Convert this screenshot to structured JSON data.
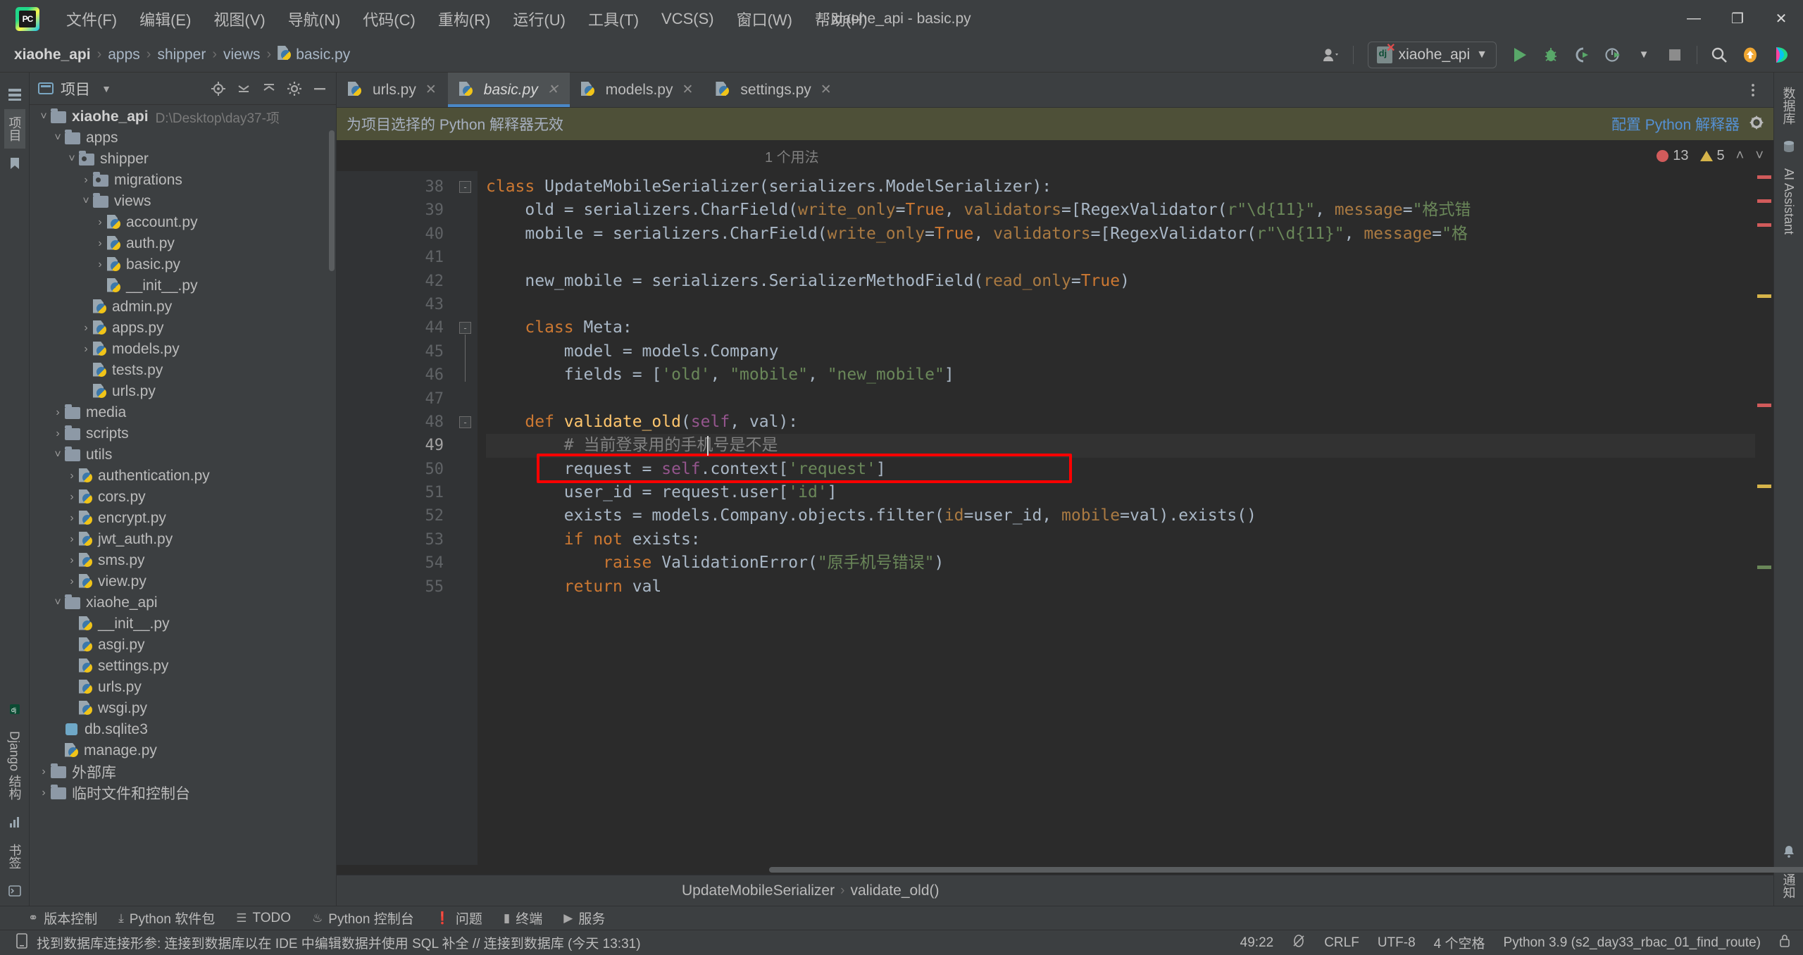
{
  "window": {
    "title": "xiaohe_api - basic.py",
    "app_icon": "pycharm-logo",
    "controls": {
      "minimize": "—",
      "maximize": "❐",
      "close": "✕"
    }
  },
  "menu": [
    {
      "label": "文件(F)",
      "name": "menu-file"
    },
    {
      "label": "编辑(E)",
      "name": "menu-edit"
    },
    {
      "label": "视图(V)",
      "name": "menu-view"
    },
    {
      "label": "导航(N)",
      "name": "menu-navigate"
    },
    {
      "label": "代码(C)",
      "name": "menu-code"
    },
    {
      "label": "重构(R)",
      "name": "menu-refactor"
    },
    {
      "label": "运行(U)",
      "name": "menu-run"
    },
    {
      "label": "工具(T)",
      "name": "menu-tools"
    },
    {
      "label": "VCS(S)",
      "name": "menu-vcs"
    },
    {
      "label": "窗口(W)",
      "name": "menu-window"
    },
    {
      "label": "帮助(H)",
      "name": "menu-help"
    }
  ],
  "breadcrumb": {
    "items": [
      "xiaohe_api",
      "apps",
      "shipper",
      "views",
      "basic.py"
    ],
    "separator": "›"
  },
  "toolbar": {
    "account_icon": "user-icon",
    "run_config": "xiaohe_api",
    "run_config_dropdown": "▼",
    "run": "run-icon",
    "debug": "debug-icon",
    "run_coverage": "run-with-coverage-icon",
    "profile": "profile-icon",
    "stop": "stop-icon",
    "search": "search-icon",
    "update": "update-project-icon",
    "ai": "ai-icon"
  },
  "left_strip": {
    "tabs": [
      "项目",
      "收藏"
    ],
    "icons": [
      "structure-icon",
      "bookmark-icon"
    ],
    "bottom_tabs": [
      "Django 结构",
      "书签"
    ]
  },
  "right_strip": {
    "tabs": [
      "数据库",
      "AI Assistant",
      "通知"
    ]
  },
  "project_panel": {
    "title": "项目",
    "dropdown": "▼",
    "header_icons": [
      "locate-icon",
      "collapse-icon",
      "expand-icon",
      "settings-icon",
      "hide-icon"
    ],
    "tree": [
      {
        "indent": 0,
        "arrow": "˅",
        "icon": "folder",
        "label": "xiaohe_api",
        "bold": true,
        "path": "D:\\Desktop\\day37-项",
        "expanded": true
      },
      {
        "indent": 1,
        "arrow": "˅",
        "icon": "folder",
        "label": "apps",
        "expanded": true
      },
      {
        "indent": 2,
        "arrow": "˅",
        "icon": "package",
        "label": "shipper",
        "expanded": true
      },
      {
        "indent": 3,
        "arrow": "›",
        "icon": "package",
        "label": "migrations"
      },
      {
        "indent": 3,
        "arrow": "˅",
        "icon": "folder",
        "label": "views",
        "expanded": true
      },
      {
        "indent": 4,
        "arrow": "›",
        "icon": "python",
        "label": "account.py"
      },
      {
        "indent": 4,
        "arrow": "›",
        "icon": "python",
        "label": "auth.py"
      },
      {
        "indent": 4,
        "arrow": "›",
        "icon": "python",
        "label": "basic.py"
      },
      {
        "indent": 4,
        "arrow": "",
        "icon": "python",
        "label": "__init__.py"
      },
      {
        "indent": 3,
        "arrow": "",
        "icon": "python",
        "label": "admin.py"
      },
      {
        "indent": 3,
        "arrow": "›",
        "icon": "python",
        "label": "apps.py"
      },
      {
        "indent": 3,
        "arrow": "›",
        "icon": "python",
        "label": "models.py"
      },
      {
        "indent": 3,
        "arrow": "",
        "icon": "python",
        "label": "tests.py"
      },
      {
        "indent": 3,
        "arrow": "",
        "icon": "python",
        "label": "urls.py"
      },
      {
        "indent": 1,
        "arrow": "›",
        "icon": "folder",
        "label": "media"
      },
      {
        "indent": 1,
        "arrow": "›",
        "icon": "folder",
        "label": "scripts"
      },
      {
        "indent": 1,
        "arrow": "˅",
        "icon": "folder",
        "label": "utils",
        "expanded": true
      },
      {
        "indent": 2,
        "arrow": "›",
        "icon": "python",
        "label": "authentication.py"
      },
      {
        "indent": 2,
        "arrow": "›",
        "icon": "python",
        "label": "cors.py"
      },
      {
        "indent": 2,
        "arrow": "›",
        "icon": "python",
        "label": "encrypt.py"
      },
      {
        "indent": 2,
        "arrow": "›",
        "icon": "python",
        "label": "jwt_auth.py"
      },
      {
        "indent": 2,
        "arrow": "›",
        "icon": "python",
        "label": "sms.py"
      },
      {
        "indent": 2,
        "arrow": "›",
        "icon": "python",
        "label": "view.py"
      },
      {
        "indent": 1,
        "arrow": "˅",
        "icon": "folder",
        "label": "xiaohe_api",
        "expanded": true
      },
      {
        "indent": 2,
        "arrow": "",
        "icon": "python",
        "label": "__init__.py"
      },
      {
        "indent": 2,
        "arrow": "",
        "icon": "python",
        "label": "asgi.py"
      },
      {
        "indent": 2,
        "arrow": "",
        "icon": "python",
        "label": "settings.py"
      },
      {
        "indent": 2,
        "arrow": "",
        "icon": "python",
        "label": "urls.py"
      },
      {
        "indent": 2,
        "arrow": "",
        "icon": "python",
        "label": "wsgi.py"
      },
      {
        "indent": 1,
        "arrow": "",
        "icon": "db",
        "label": "db.sqlite3"
      },
      {
        "indent": 1,
        "arrow": "",
        "icon": "python",
        "label": "manage.py"
      },
      {
        "indent": 0,
        "arrow": "›",
        "icon": "folder",
        "label": "外部库"
      },
      {
        "indent": 0,
        "arrow": "›",
        "icon": "folder",
        "label": "临时文件和控制台"
      }
    ]
  },
  "editor_tabs": [
    {
      "label": "urls.py",
      "active": false,
      "close": "✕"
    },
    {
      "label": "basic.py",
      "active": true,
      "close": "✕"
    },
    {
      "label": "models.py",
      "active": false,
      "close": "✕"
    },
    {
      "label": "settings.py",
      "active": false,
      "close": "✕"
    }
  ],
  "warning_bar": {
    "message": "为项目选择的 Python 解释器无效",
    "action": "配置 Python 解释器",
    "gear_icon": "gear-icon"
  },
  "usage_hint": {
    "text": "1 个用法",
    "errors": "13",
    "warnings": "5",
    "up_arrow": "˄",
    "down_arrow": "˅"
  },
  "code": {
    "first_line_number": 38,
    "lines": [
      {
        "n": 38,
        "tokens": [
          {
            "t": "class ",
            "c": "kw"
          },
          {
            "t": "UpdateMobileSerializer",
            "c": "cls"
          },
          {
            "t": "(serializers.ModelSerializer):",
            "c": "punct"
          }
        ]
      },
      {
        "n": 39,
        "tokens": [
          {
            "t": "    old = serializers.CharField(",
            "c": "punct"
          },
          {
            "t": "write_only",
            "c": "param"
          },
          {
            "t": "=",
            "c": "punct"
          },
          {
            "t": "True",
            "c": "kw"
          },
          {
            "t": ", ",
            "c": "punct"
          },
          {
            "t": "validators",
            "c": "param"
          },
          {
            "t": "=[RegexValidator(",
            "c": "punct"
          },
          {
            "t": "r\"\\d{11}\"",
            "c": "str"
          },
          {
            "t": ", ",
            "c": "punct"
          },
          {
            "t": "message",
            "c": "param"
          },
          {
            "t": "=",
            "c": "punct"
          },
          {
            "t": "\"格式错",
            "c": "str"
          }
        ]
      },
      {
        "n": 40,
        "tokens": [
          {
            "t": "    mobile = serializers.CharField(",
            "c": "punct"
          },
          {
            "t": "write_only",
            "c": "param"
          },
          {
            "t": "=",
            "c": "punct"
          },
          {
            "t": "True",
            "c": "kw"
          },
          {
            "t": ", ",
            "c": "punct"
          },
          {
            "t": "validators",
            "c": "param"
          },
          {
            "t": "=[RegexValidator(",
            "c": "punct"
          },
          {
            "t": "r\"\\d{11}\"",
            "c": "str"
          },
          {
            "t": ", ",
            "c": "punct"
          },
          {
            "t": "message",
            "c": "param"
          },
          {
            "t": "=",
            "c": "punct"
          },
          {
            "t": "\"格",
            "c": "str"
          }
        ]
      },
      {
        "n": 41,
        "tokens": []
      },
      {
        "n": 42,
        "tokens": [
          {
            "t": "    new_mobile = serializers.SerializerMethodField(",
            "c": "punct"
          },
          {
            "t": "read_only",
            "c": "param"
          },
          {
            "t": "=",
            "c": "punct"
          },
          {
            "t": "True",
            "c": "kw"
          },
          {
            "t": ")",
            "c": "punct"
          }
        ]
      },
      {
        "n": 43,
        "tokens": []
      },
      {
        "n": 44,
        "tokens": [
          {
            "t": "    class ",
            "c": "kw"
          },
          {
            "t": "Meta",
            "c": "cls"
          },
          {
            "t": ":",
            "c": "punct"
          }
        ]
      },
      {
        "n": 45,
        "tokens": [
          {
            "t": "        model = models.Company",
            "c": "punct"
          }
        ]
      },
      {
        "n": 46,
        "tokens": [
          {
            "t": "        fields = [",
            "c": "punct"
          },
          {
            "t": "'old'",
            "c": "str"
          },
          {
            "t": ", ",
            "c": "punct"
          },
          {
            "t": "\"mobile\"",
            "c": "str"
          },
          {
            "t": ", ",
            "c": "punct"
          },
          {
            "t": "\"new_mobile\"",
            "c": "str"
          },
          {
            "t": "]",
            "c": "punct"
          }
        ]
      },
      {
        "n": 47,
        "tokens": []
      },
      {
        "n": 48,
        "tokens": [
          {
            "t": "    def ",
            "c": "kw"
          },
          {
            "t": "validate_old",
            "c": "fn"
          },
          {
            "t": "(",
            "c": "punct"
          },
          {
            "t": "self",
            "c": "self"
          },
          {
            "t": ", val):",
            "c": "punct"
          }
        ]
      },
      {
        "n": 49,
        "tokens": [
          {
            "t": "        # 当前登录用的手机号是不是",
            "c": "cmt"
          }
        ],
        "current": true
      },
      {
        "n": 50,
        "tokens": [
          {
            "t": "        request = ",
            "c": "punct"
          },
          {
            "t": "self",
            "c": "self"
          },
          {
            "t": ".context[",
            "c": "punct"
          },
          {
            "t": "'request'",
            "c": "str"
          },
          {
            "t": "]",
            "c": "punct"
          }
        ],
        "boxed": true
      },
      {
        "n": 51,
        "tokens": [
          {
            "t": "        user_id = request.user[",
            "c": "punct"
          },
          {
            "t": "'id'",
            "c": "str"
          },
          {
            "t": "]",
            "c": "punct"
          }
        ]
      },
      {
        "n": 52,
        "tokens": [
          {
            "t": "        exists = models.Company.objects.filter(",
            "c": "punct"
          },
          {
            "t": "id",
            "c": "param"
          },
          {
            "t": "=user_id, ",
            "c": "punct"
          },
          {
            "t": "mobile",
            "c": "param"
          },
          {
            "t": "=val).exists()",
            "c": "punct"
          }
        ]
      },
      {
        "n": 53,
        "tokens": [
          {
            "t": "        if not ",
            "c": "kw"
          },
          {
            "t": "exists:",
            "c": "punct"
          }
        ]
      },
      {
        "n": 54,
        "tokens": [
          {
            "t": "            raise ",
            "c": "kw"
          },
          {
            "t": "ValidationError(",
            "c": "punct"
          },
          {
            "t": "\"原手机号错误\"",
            "c": "str"
          },
          {
            "t": ")",
            "c": "punct"
          }
        ]
      },
      {
        "n": 55,
        "tokens": [
          {
            "t": "        return ",
            "c": "kw"
          },
          {
            "t": "val",
            "c": "punct"
          }
        ]
      }
    ]
  },
  "editor_breadcrumb": {
    "items": [
      "UpdateMobileSerializer",
      "validate_old()"
    ],
    "separator": "›"
  },
  "bottom_toolwindows": [
    {
      "label": "版本控制",
      "icon": "branch-icon"
    },
    {
      "label": "Python 软件包",
      "icon": "packages-icon"
    },
    {
      "label": "TODO",
      "icon": "todo-icon"
    },
    {
      "label": "Python 控制台",
      "icon": "python-console-icon"
    },
    {
      "label": "问题",
      "icon": "problems-icon"
    },
    {
      "label": "终端",
      "icon": "terminal-icon"
    },
    {
      "label": "服务",
      "icon": "services-icon"
    }
  ],
  "status_bar": {
    "message_icon": "database-icon",
    "message": "找到数据库连接形参: 连接到数据库以在 IDE 中编辑数据并使用 SQL 补全 // 连接到数据库 (今天 13:31)",
    "caret_position": "49:22",
    "read_only_icon": "no-edit-icon",
    "line_separator": "CRLF",
    "encoding": "UTF-8",
    "indent": "4 个空格",
    "interpreter": "Python 3.9 (s2_day33_rbac_01_find_route)",
    "lock_icon": "lock-icon"
  },
  "colors": {
    "accent": "#4a88c7",
    "warning_bg": "#4e5038",
    "editor_bg": "#2b2b2b",
    "panel_bg": "#3c3f41",
    "highlight_box": "#ff0000",
    "link": "#5591d4"
  }
}
